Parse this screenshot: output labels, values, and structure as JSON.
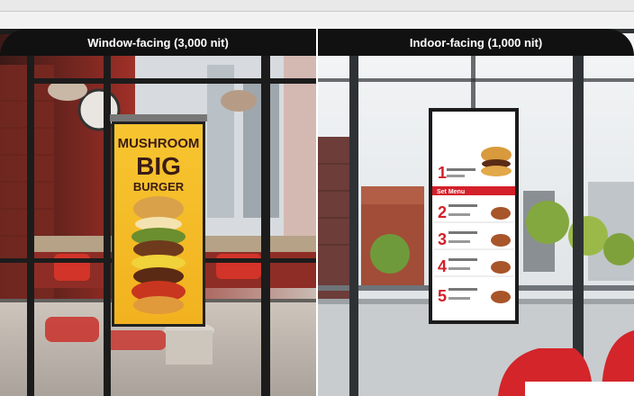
{
  "header": {
    "left_label": "Window-facing (3,000 nit)",
    "right_label": "Indoor-facing (1,000 nit)"
  },
  "left_display": {
    "line1": "MUSHROOM",
    "line2": "BIG",
    "line3": "BURGER"
  },
  "right_display": {
    "section": "Set Menu",
    "items": [
      "1",
      "2",
      "3",
      "4",
      "5"
    ]
  }
}
